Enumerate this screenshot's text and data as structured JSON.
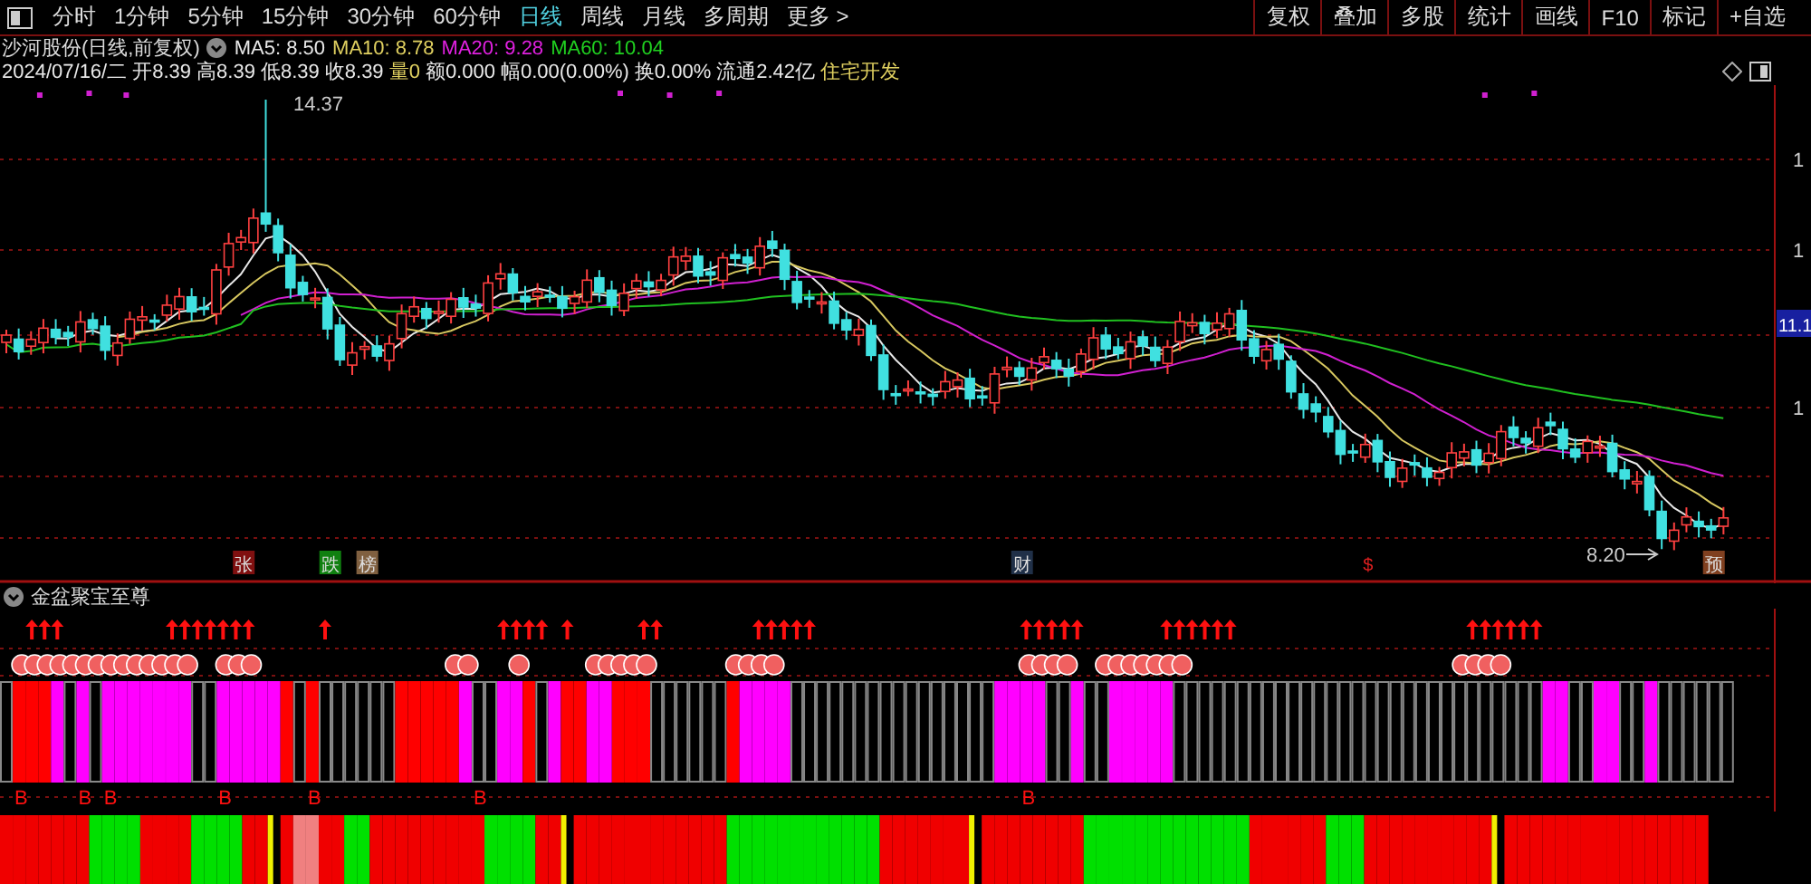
{
  "toolbar": {
    "periods": [
      {
        "label": "分时",
        "selected": false
      },
      {
        "label": "1分钟",
        "selected": false
      },
      {
        "label": "5分钟",
        "selected": false
      },
      {
        "label": "15分钟",
        "selected": false
      },
      {
        "label": "30分钟",
        "selected": false
      },
      {
        "label": "60分钟",
        "selected": false
      },
      {
        "label": "日线",
        "selected": true
      },
      {
        "label": "周线",
        "selected": false
      },
      {
        "label": "月线",
        "selected": false
      },
      {
        "label": "多周期",
        "selected": false
      },
      {
        "label": "更多 >",
        "selected": false
      }
    ],
    "buttons": [
      "复权",
      "叠加",
      "多股",
      "统计",
      "画线",
      "F10",
      "标记",
      "+自选"
    ]
  },
  "info": {
    "title": "沙河股份(日线,前复权)",
    "averages": [
      {
        "text": "MA5: 8.50",
        "color": "#e8e8e8"
      },
      {
        "text": "MA10: 8.78",
        "color": "#e0d060"
      },
      {
        "text": "MA20: 9.28",
        "color": "#e020e0"
      },
      {
        "text": "MA60: 10.04",
        "color": "#20d020"
      }
    ],
    "quote": [
      {
        "text": "2024/07/16/二",
        "color": "#e8e8e8"
      },
      {
        "text": "开8.39",
        "color": "#e8e8e8"
      },
      {
        "text": "高8.39",
        "color": "#e8e8e8"
      },
      {
        "text": "低8.39",
        "color": "#e8e8e8"
      },
      {
        "text": "收8.39",
        "color": "#e8e8e8"
      },
      {
        "text": "量0",
        "color": "#e0d060"
      },
      {
        "text": "额0.000",
        "color": "#e8e8e8"
      },
      {
        "text": "幅0.00(0.00%)",
        "color": "#e8e8e8"
      },
      {
        "text": "换0.00%",
        "color": "#e8e8e8"
      },
      {
        "text": "流通2.42亿",
        "color": "#e8e8e8"
      },
      {
        "text": "住宅开发",
        "color": "#e0d060"
      }
    ]
  },
  "chart": {
    "high_label": "14.37",
    "low_label": "8.20",
    "price_tag": "11.1",
    "axis_labels": [
      "1",
      "1",
      "1"
    ],
    "markers": [
      {
        "text": "张",
        "kind": "rise"
      },
      {
        "text": "跌",
        "kind": "fall"
      },
      {
        "text": "榜",
        "kind": "rank"
      },
      {
        "text": "财",
        "kind": "finance"
      },
      {
        "text": "$",
        "kind": "money"
      },
      {
        "text": "预",
        "kind": "forecast"
      }
    ]
  },
  "indicator": {
    "title": "金盆聚宝至尊",
    "signals": [
      "B",
      "B",
      "B",
      "B",
      "B",
      "B",
      "B"
    ]
  }
}
